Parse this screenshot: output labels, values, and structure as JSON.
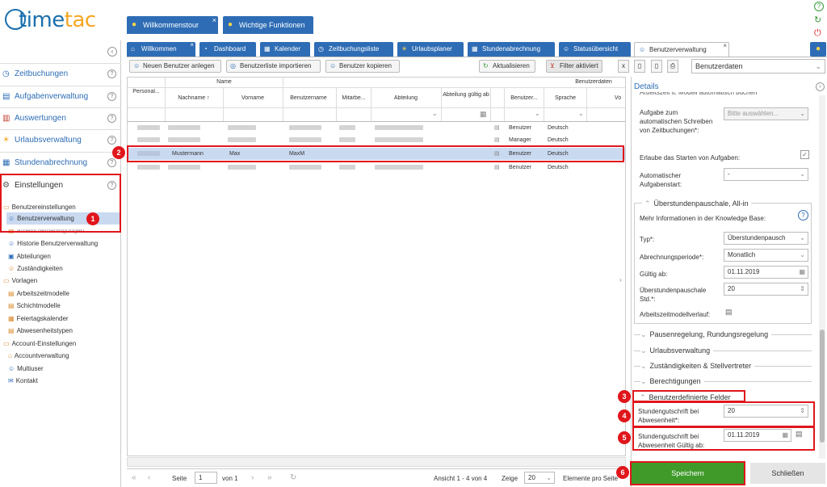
{
  "logo": {
    "text_a": "t",
    "text_b": "ime",
    "text_c": "tac"
  },
  "top_tabs": [
    {
      "label": "Willkommenstour",
      "icon": "bulb-icon"
    },
    {
      "label": "Wichtige Funktionen",
      "icon": "bulb-icon"
    }
  ],
  "nav": {
    "zeit": "Zeitbuchungen",
    "aufgaben": "Aufgabenverwaltung",
    "auswertungen": "Auswertungen",
    "urlaub": "Urlaubsverwaltung",
    "stunden": "Stundenabrechnung",
    "einstellungen": "Einstellungen",
    "help": "?"
  },
  "tree": {
    "benutzereinstellungen": "Benutzereinstellungen",
    "benutzerverwaltung": "Benutzerverwaltung",
    "hidden": "Arbeitszeitbedingungen",
    "historie": "Historie Benutzerverwaltung",
    "abteilungen": "Abteilungen",
    "zustaendig": "Zuständigkeiten",
    "vorlagen": "Vorlagen",
    "azm": "Arbeitszeitmodelle",
    "schicht": "Schichtmodelle",
    "feiertag": "Feiertagskalender",
    "abwesen": "Abwesenheitstypen",
    "account": "Account-Einstellungen",
    "accountv": "Accountverwaltung",
    "multiuser": "Multiuser",
    "kontakt": "Kontakt"
  },
  "tabs": {
    "willkommen": "Willkommen",
    "dashboard": "Dashboard",
    "kalender": "Kalender",
    "zeitbuchungsliste": "Zeitbuchungsliste",
    "urlaubsplaner": "Urlaubsplaner",
    "stundenabrechnung": "Stundenabrechnung",
    "status": "Statusübersicht",
    "benutzerverwaltung": "Benutzerverwaltung"
  },
  "toolbar": {
    "neu": "Neuen Benutzer anlegen",
    "import": "Benutzerliste importieren",
    "kopie": "Benutzer kopieren",
    "aktual": "Aktualisieren",
    "filter": "Filter aktiviert",
    "view": "Benutzerdaten"
  },
  "grid": {
    "h_personal": "Personal...",
    "h_name": "Name",
    "h_nach": "Nachname",
    "h_vor": "Vorname",
    "h_daten": "Benutzerdaten",
    "h_bn": "Benutzername",
    "h_mit": "Mitarbe...",
    "h_abt": "Abteilung",
    "h_abtg": "Abteilung gültig ab",
    "h_ben": "Benutzer...",
    "h_spr": "Sprache",
    "h_vo": "Vo",
    "rows": [
      {
        "nach": "",
        "vor": "",
        "bn": "",
        "typ": "Benutzer",
        "spr": "Deutsch"
      },
      {
        "nach": "",
        "vor": "",
        "bn": "",
        "typ": "Manager",
        "spr": "Deutsch"
      },
      {
        "nach": "Mustermann",
        "vor": "Max",
        "bn": "MaxM",
        "typ": "Benutzer",
        "spr": "Deutsch"
      },
      {
        "nach": "",
        "vor": "",
        "bn": "",
        "typ": "Benutzer",
        "spr": "Deutsch"
      }
    ]
  },
  "pager": {
    "seite": "Seite",
    "page": "1",
    "von": "von 1",
    "ansicht": "Ansicht 1 - 4 von 4",
    "zeige": "Zeige",
    "per": "20",
    "pro": "Elemente pro Seite"
  },
  "details": {
    "title": "Details",
    "top_cut": "Arbeitszeit lt. Modell automatisch buchen",
    "aufgabe_label": "Aufgabe zum automatischen Schreiben von Zeitbuchungen*:",
    "aufgabe_val": "Bitte auswählen...",
    "erlaube": "Erlaube das Starten von Aufgaben:",
    "autostart_label": "Automatischer Aufgabenstart:",
    "autostart_val": "-",
    "ueber_title": "Überstundenpauschale, All-in",
    "kb": "Mehr Informationen in der Knowledge Base:",
    "typ_label": "Typ*:",
    "typ_val": "Überstundenpausch",
    "abrech_label": "Abrechnungsperiode*:",
    "abrech_val": "Monatlich",
    "gueltig_label": "Gültig ab:",
    "gueltig_val": "01.11.2019",
    "std_label": "Überstundenpauschale Std.*:",
    "std_val": "20",
    "verlauf": "Arbeitszeitmodellverlauf:",
    "pausen": "Pausenregelung, Rundungsregelung",
    "urlaub": "Urlaubsverwaltung",
    "zust": "Zuständigkeiten & Stellvertreter",
    "berecht": "Berechtigungen",
    "bdf": "Benutzerdefinierte Felder",
    "gut_label": "Stundengutschrift bei Abwesenheit*:",
    "gut_val": "20",
    "gutg_label": "Stundengutschrift bei Abwesenheit Gültig ab:",
    "gutg_val": "01.11.2019",
    "speichern": "Speichern",
    "schliessen": "Schließen"
  },
  "badges": [
    "1",
    "2",
    "3",
    "4",
    "5",
    "6"
  ],
  "colors": {
    "brand": "#2e6db5",
    "accent": "#f5a623",
    "highlight": "#e0161b",
    "save": "#3f9a2a"
  }
}
